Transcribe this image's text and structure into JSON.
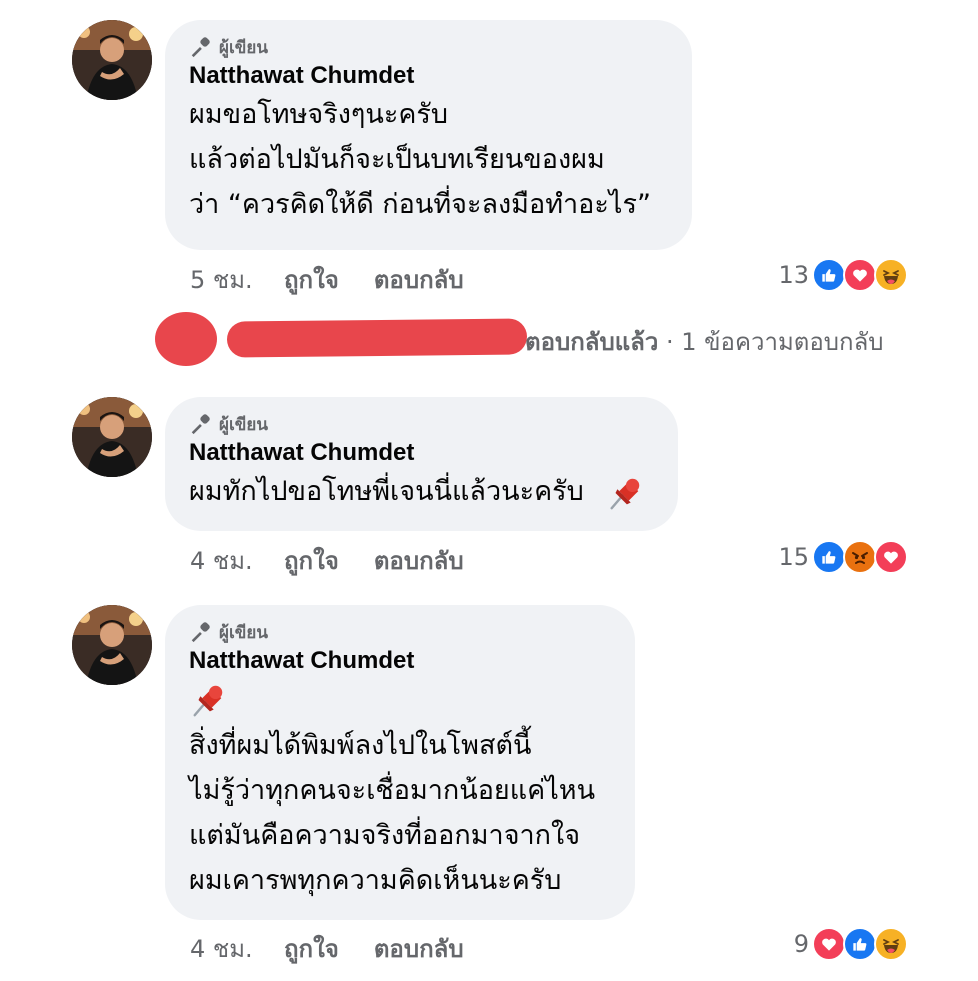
{
  "comments": [
    {
      "badge": "ผู้เขียน",
      "author": "Natthawat Chumdet",
      "lines": [
        "ผมขอโทษจริงๆนะครับ",
        "แล้วต่อไปมันก็จะเป็นบทเรียนของผม",
        "ว่า “ควรคิดให้ดี ก่อนที่จะลงมือทำอะไร”"
      ],
      "time": "5 ชม.",
      "like_label": "ถูกใจ",
      "reply_label": "ตอบกลับ",
      "reaction_count": "13",
      "reactions": [
        "like-icon",
        "love-icon",
        "haha-icon"
      ]
    },
    {
      "badge": "ผู้เขียน",
      "author": "Natthawat Chumdet",
      "lines": [
        "ผมทักไปขอโทษพี่เจนนี่แล้วนะครับ"
      ],
      "time": "4 ชม.",
      "like_label": "ถูกใจ",
      "reply_label": "ตอบกลับ",
      "reaction_count": "15",
      "reactions": [
        "like-icon",
        "angry-icon",
        "love-icon"
      ]
    },
    {
      "badge": "ผู้เขียน",
      "author": "Natthawat Chumdet",
      "lines": [
        "สิ่งที่ผมได้พิมพ์ลงไปในโพสต์นี้",
        "ไม่รู้ว่าทุกคนจะเชื่อมากน้อยแค่ไหน",
        "แต่มันคือความจริงที่ออกมาจากใจ",
        "ผมเคารพทุกความคิดเห็นนะครับ"
      ],
      "time": "4 ชม.",
      "like_label": "ถูกใจ",
      "reply_label": "ตอบกลับ",
      "reaction_count": "9",
      "reactions": [
        "love-icon",
        "like-icon",
        "haha-icon"
      ]
    }
  ],
  "replies_row": {
    "replied_label": "ตอบกลับแล้ว",
    "separator": " · ",
    "count_label": "1 ข้อความตอบกลับ"
  },
  "colors": {
    "bubble": "#f0f2f5",
    "like": "#1877f2",
    "love": "#f33e58",
    "haha": "#f7b125",
    "angry": "#e9710f",
    "redaction": "#e8464c"
  }
}
